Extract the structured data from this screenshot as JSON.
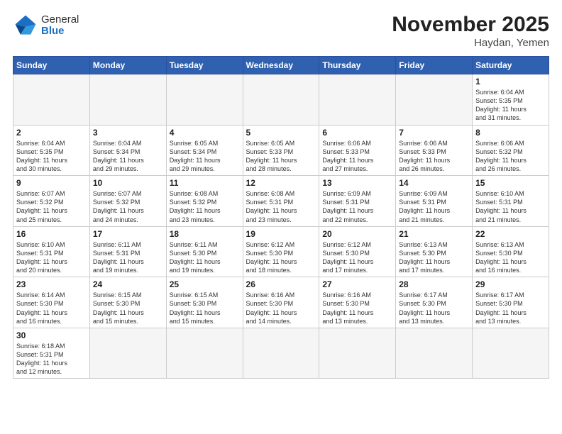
{
  "header": {
    "logo_general": "General",
    "logo_blue": "Blue",
    "month": "November 2025",
    "location": "Haydan, Yemen"
  },
  "weekdays": [
    "Sunday",
    "Monday",
    "Tuesday",
    "Wednesday",
    "Thursday",
    "Friday",
    "Saturday"
  ],
  "weeks": [
    [
      {
        "day": "",
        "info": ""
      },
      {
        "day": "",
        "info": ""
      },
      {
        "day": "",
        "info": ""
      },
      {
        "day": "",
        "info": ""
      },
      {
        "day": "",
        "info": ""
      },
      {
        "day": "",
        "info": ""
      },
      {
        "day": "1",
        "info": "Sunrise: 6:04 AM\nSunset: 5:35 PM\nDaylight: 11 hours\nand 31 minutes."
      }
    ],
    [
      {
        "day": "2",
        "info": "Sunrise: 6:04 AM\nSunset: 5:35 PM\nDaylight: 11 hours\nand 30 minutes."
      },
      {
        "day": "3",
        "info": "Sunrise: 6:04 AM\nSunset: 5:34 PM\nDaylight: 11 hours\nand 29 minutes."
      },
      {
        "day": "4",
        "info": "Sunrise: 6:05 AM\nSunset: 5:34 PM\nDaylight: 11 hours\nand 29 minutes."
      },
      {
        "day": "5",
        "info": "Sunrise: 6:05 AM\nSunset: 5:33 PM\nDaylight: 11 hours\nand 28 minutes."
      },
      {
        "day": "6",
        "info": "Sunrise: 6:06 AM\nSunset: 5:33 PM\nDaylight: 11 hours\nand 27 minutes."
      },
      {
        "day": "7",
        "info": "Sunrise: 6:06 AM\nSunset: 5:33 PM\nDaylight: 11 hours\nand 26 minutes."
      },
      {
        "day": "8",
        "info": "Sunrise: 6:06 AM\nSunset: 5:32 PM\nDaylight: 11 hours\nand 26 minutes."
      }
    ],
    [
      {
        "day": "9",
        "info": "Sunrise: 6:07 AM\nSunset: 5:32 PM\nDaylight: 11 hours\nand 25 minutes."
      },
      {
        "day": "10",
        "info": "Sunrise: 6:07 AM\nSunset: 5:32 PM\nDaylight: 11 hours\nand 24 minutes."
      },
      {
        "day": "11",
        "info": "Sunrise: 6:08 AM\nSunset: 5:32 PM\nDaylight: 11 hours\nand 23 minutes."
      },
      {
        "day": "12",
        "info": "Sunrise: 6:08 AM\nSunset: 5:31 PM\nDaylight: 11 hours\nand 23 minutes."
      },
      {
        "day": "13",
        "info": "Sunrise: 6:09 AM\nSunset: 5:31 PM\nDaylight: 11 hours\nand 22 minutes."
      },
      {
        "day": "14",
        "info": "Sunrise: 6:09 AM\nSunset: 5:31 PM\nDaylight: 11 hours\nand 21 minutes."
      },
      {
        "day": "15",
        "info": "Sunrise: 6:10 AM\nSunset: 5:31 PM\nDaylight: 11 hours\nand 21 minutes."
      }
    ],
    [
      {
        "day": "16",
        "info": "Sunrise: 6:10 AM\nSunset: 5:31 PM\nDaylight: 11 hours\nand 20 minutes."
      },
      {
        "day": "17",
        "info": "Sunrise: 6:11 AM\nSunset: 5:31 PM\nDaylight: 11 hours\nand 19 minutes."
      },
      {
        "day": "18",
        "info": "Sunrise: 6:11 AM\nSunset: 5:30 PM\nDaylight: 11 hours\nand 19 minutes."
      },
      {
        "day": "19",
        "info": "Sunrise: 6:12 AM\nSunset: 5:30 PM\nDaylight: 11 hours\nand 18 minutes."
      },
      {
        "day": "20",
        "info": "Sunrise: 6:12 AM\nSunset: 5:30 PM\nDaylight: 11 hours\nand 17 minutes."
      },
      {
        "day": "21",
        "info": "Sunrise: 6:13 AM\nSunset: 5:30 PM\nDaylight: 11 hours\nand 17 minutes."
      },
      {
        "day": "22",
        "info": "Sunrise: 6:13 AM\nSunset: 5:30 PM\nDaylight: 11 hours\nand 16 minutes."
      }
    ],
    [
      {
        "day": "23",
        "info": "Sunrise: 6:14 AM\nSunset: 5:30 PM\nDaylight: 11 hours\nand 16 minutes."
      },
      {
        "day": "24",
        "info": "Sunrise: 6:15 AM\nSunset: 5:30 PM\nDaylight: 11 hours\nand 15 minutes."
      },
      {
        "day": "25",
        "info": "Sunrise: 6:15 AM\nSunset: 5:30 PM\nDaylight: 11 hours\nand 15 minutes."
      },
      {
        "day": "26",
        "info": "Sunrise: 6:16 AM\nSunset: 5:30 PM\nDaylight: 11 hours\nand 14 minutes."
      },
      {
        "day": "27",
        "info": "Sunrise: 6:16 AM\nSunset: 5:30 PM\nDaylight: 11 hours\nand 13 minutes."
      },
      {
        "day": "28",
        "info": "Sunrise: 6:17 AM\nSunset: 5:30 PM\nDaylight: 11 hours\nand 13 minutes."
      },
      {
        "day": "29",
        "info": "Sunrise: 6:17 AM\nSunset: 5:30 PM\nDaylight: 11 hours\nand 13 minutes."
      }
    ],
    [
      {
        "day": "30",
        "info": "Sunrise: 6:18 AM\nSunset: 5:31 PM\nDaylight: 11 hours\nand 12 minutes."
      },
      {
        "day": "",
        "info": ""
      },
      {
        "day": "",
        "info": ""
      },
      {
        "day": "",
        "info": ""
      },
      {
        "day": "",
        "info": ""
      },
      {
        "day": "",
        "info": ""
      },
      {
        "day": "",
        "info": ""
      }
    ]
  ]
}
